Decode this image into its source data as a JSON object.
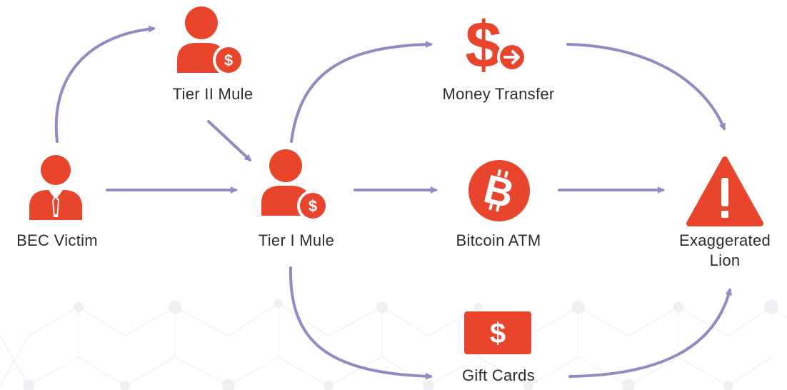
{
  "colors": {
    "icon": "#e8452c",
    "arrow": "#8f8bc3",
    "text": "#2c2c2c",
    "background_pattern": "#e9e9ef"
  },
  "nodes": {
    "bec_victim": {
      "label": "BEC Victim",
      "icon": "business-person-icon"
    },
    "tier2_mule": {
      "label": "Tier II Mule",
      "icon": "person-dollar-icon"
    },
    "tier1_mule": {
      "label": "Tier I Mule",
      "icon": "person-dollar-icon"
    },
    "money_transfer": {
      "label": "Money Transfer",
      "icon": "dollar-arrow-icon"
    },
    "bitcoin_atm": {
      "label": "Bitcoin ATM",
      "icon": "bitcoin-icon"
    },
    "gift_cards": {
      "label": "Gift Cards",
      "icon": "gift-card-dollar-icon"
    },
    "destination": {
      "label_line1": "Exaggerated",
      "label_line2": "Lion",
      "icon": "warning-triangle-icon"
    }
  },
  "edges": [
    {
      "from": "bec_victim",
      "to": "tier2_mule"
    },
    {
      "from": "bec_victim",
      "to": "tier1_mule"
    },
    {
      "from": "tier2_mule",
      "to": "tier1_mule"
    },
    {
      "from": "tier1_mule",
      "to": "money_transfer"
    },
    {
      "from": "tier1_mule",
      "to": "bitcoin_atm"
    },
    {
      "from": "tier1_mule",
      "to": "gift_cards"
    },
    {
      "from": "money_transfer",
      "to": "destination"
    },
    {
      "from": "bitcoin_atm",
      "to": "destination"
    },
    {
      "from": "gift_cards",
      "to": "destination"
    }
  ]
}
